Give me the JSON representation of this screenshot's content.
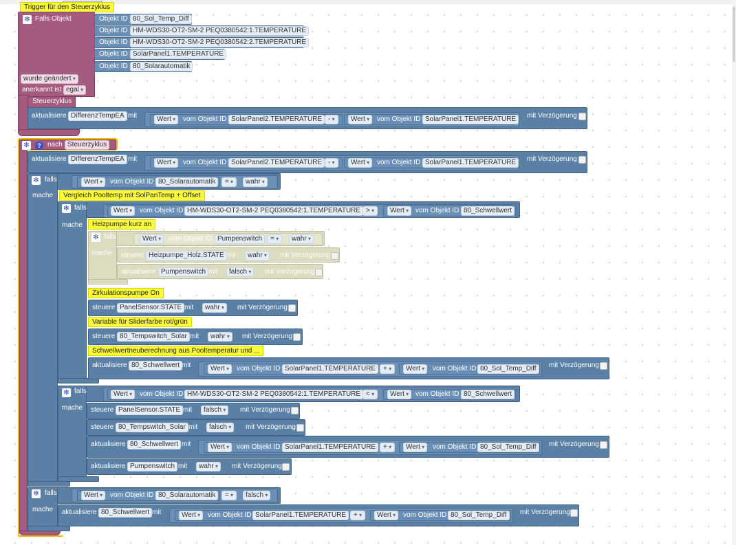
{
  "trigger": {
    "comment": "Trigger für den Steuerzyklus",
    "falls_objekt_label": "Falls Objekt",
    "objekt_id_label": "Objekt ID",
    "object_ids": [
      "80_Sol_Temp_Diff",
      "HM-WDS30-OT2-SM-2 PEQ0380542:1.TEMPERATURE",
      "HM-WDS30-OT2-SM-2 PEQ0380542:2.TEMPERATURE",
      "SolarPanel1.TEMPERATURE",
      "80_Solarautomatik"
    ],
    "wurde_geaendert": "wurde geändert",
    "anerkannt_ist": "anerkannt ist",
    "anerkannt_value": "egal",
    "schedule_name": "Steuerzyklus",
    "aktualisiere_label": "aktualisiere",
    "var1": "DifferenzTempEA",
    "mit": "mit",
    "wert": "Wert",
    "vom_objekt_id": "vom Objekt ID",
    "obj_a": "SolarPanel2.TEMPERATURE",
    "minus": "-",
    "obj_b": "SolarPanel1.TEMPERATURE",
    "mit_verzoegerung": "mit Verzögerung"
  },
  "nach": {
    "label": "nach",
    "name": "Steuerzyklus",
    "falls": "falls",
    "mache": "mache",
    "steuere": "steuere",
    "eq": "=",
    "gt": ">",
    "lt": "<",
    "plus": "+",
    "obj_auto": "80_Solarautomatik",
    "wahr": "wahr",
    "falsch": "falsch",
    "comment_vergleich": "Vergleich Pooltemp mit SolPanTemp + Offset",
    "obj_hm1": "HM-WDS30-OT2-SM-2 PEQ0380542:1.TEMPERATURE",
    "obj_schwell": "80_Schwellwert",
    "comment_heiz": "Heizpumpe kurz an",
    "obj_pumpenswitch": "Pumpenswitch",
    "obj_heizpumpe": "Heizpumpe_Holz.STATE",
    "comment_zirk": "Zirkulationspumpe On",
    "obj_panelsensor": "PanelSensor.STATE",
    "comment_slider": "Variable für Sliderfarbe rot/grün",
    "obj_tempswitch": "80_Tempswitch_Solar",
    "comment_schwell": "Schwellwertneuberechnung aus Pooltemperatur und ...",
    "obj_panel1": "SolarPanel1.TEMPERATURE",
    "obj_soltempdiff": "80_Sol_Temp_Diff"
  },
  "colors": {
    "trigger": "#a55b80",
    "update": "#5b80a5",
    "comment": "#fbfb3c",
    "outline": "#f5b800"
  }
}
